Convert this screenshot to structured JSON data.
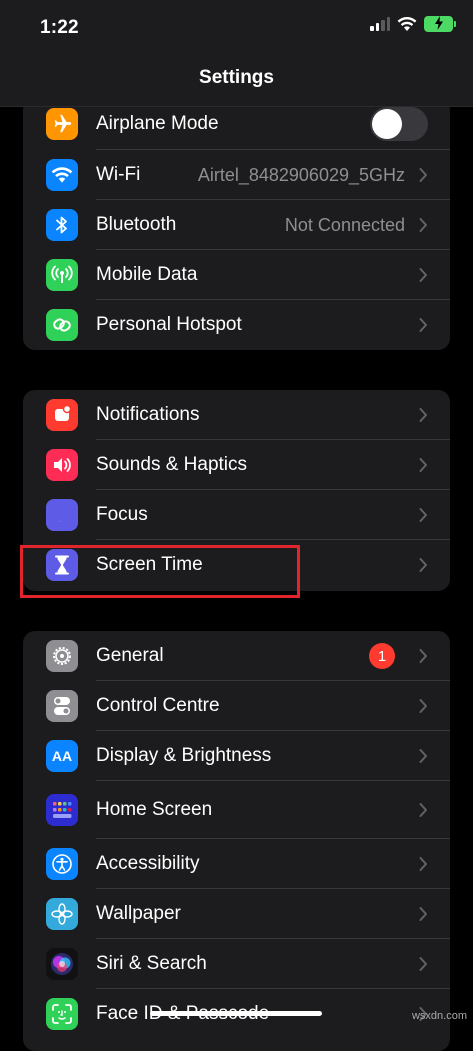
{
  "status_bar": {
    "time": "1:22"
  },
  "nav": {
    "title": "Settings"
  },
  "group1": {
    "items": [
      {
        "label": "Airplane Mode",
        "icon": "airplane-icon",
        "color": "#ff9500",
        "toggle_on": false
      },
      {
        "label": "Wi-Fi",
        "value": "Airtel_8482906029_5GHz",
        "icon": "wifi-icon",
        "color": "#0a84ff"
      },
      {
        "label": "Bluetooth",
        "value": "Not Connected",
        "icon": "bluetooth-icon",
        "color": "#0a84ff"
      },
      {
        "label": "Mobile Data",
        "icon": "antenna-icon",
        "color": "#30d158"
      },
      {
        "label": "Personal Hotspot",
        "icon": "hotspot-icon",
        "color": "#30d158"
      }
    ]
  },
  "group2": {
    "items": [
      {
        "label": "Notifications",
        "icon": "bell-icon",
        "color": "#ff3b30"
      },
      {
        "label": "Sounds & Haptics",
        "icon": "speaker-icon",
        "color": "#ff2d55"
      },
      {
        "label": "Focus",
        "icon": "moon-icon",
        "color": "#5e5ce6"
      },
      {
        "label": "Screen Time",
        "icon": "hourglass-icon",
        "color": "#5e5ce6"
      }
    ]
  },
  "group3": {
    "items": [
      {
        "label": "General",
        "badge": "1",
        "icon": "gear-icon",
        "color": "#8e8e93"
      },
      {
        "label": "Control Centre",
        "icon": "switches-icon",
        "color": "#8e8e93"
      },
      {
        "label": "Display & Brightness",
        "icon": "text-size-icon",
        "color": "#0a84ff"
      },
      {
        "label": "Home Screen",
        "icon": "app-grid-icon",
        "color": "#3a3ad6"
      },
      {
        "label": "Accessibility",
        "icon": "accessibility-icon",
        "color": "#0a84ff"
      },
      {
        "label": "Wallpaper",
        "icon": "flower-icon",
        "color": "#34aadc"
      },
      {
        "label": "Siri & Search",
        "icon": "siri-icon",
        "color": "#1c1c1e"
      },
      {
        "label": "Face ID & Passcode",
        "icon": "face-id-icon",
        "color": "#30d158"
      }
    ]
  },
  "watermark": "wsxdn.com"
}
